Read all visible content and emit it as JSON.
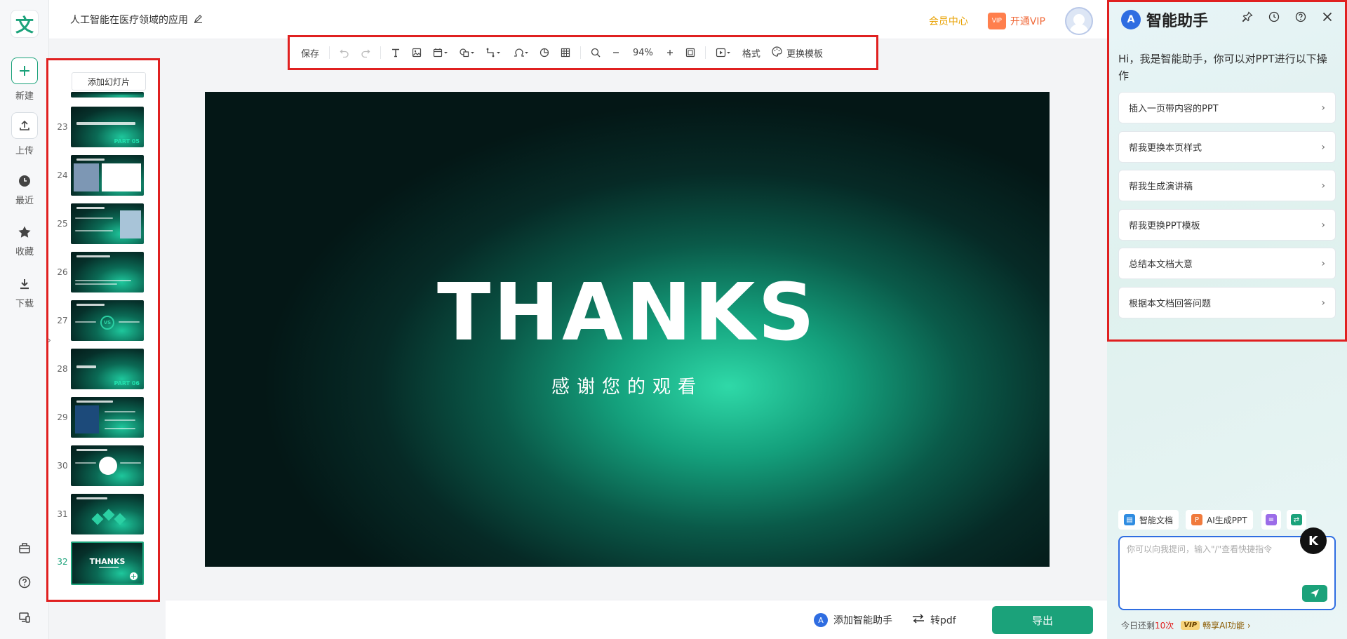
{
  "rail": {
    "logo": "文",
    "items": [
      {
        "label": "新建"
      },
      {
        "label": "上传"
      },
      {
        "label": "最近"
      },
      {
        "label": "收藏"
      },
      {
        "label": "下载"
      }
    ]
  },
  "header": {
    "doc_title": "人工智能在医疗领域的应用",
    "member_center": "会员中心",
    "open_vip": "开通VIP",
    "vip_badge": "VIP"
  },
  "toolbar": {
    "save": "保存",
    "zoom": "94%",
    "format": "格式",
    "change_template": "更换模板"
  },
  "slides": {
    "add_label": "添加幻灯片",
    "items": [
      {
        "num": "23",
        "part": "PART  05"
      },
      {
        "num": "24"
      },
      {
        "num": "25"
      },
      {
        "num": "26"
      },
      {
        "num": "27",
        "vs": "VS"
      },
      {
        "num": "28",
        "part": "PART  06"
      },
      {
        "num": "29"
      },
      {
        "num": "30"
      },
      {
        "num": "31"
      },
      {
        "num": "32",
        "thanks": "THANKS"
      }
    ]
  },
  "canvas": {
    "title": "THANKS",
    "subtitle": "感谢您的观看"
  },
  "bottom": {
    "add_assistant": "添加智能助手",
    "to_pdf": "转pdf",
    "export": "导出"
  },
  "assistant": {
    "title": "智能助手",
    "logo_glyph": "A",
    "greeting": "Hi，我是智能助手，你可以对PPT进行以下操作",
    "options": [
      "插入一页带内容的PPT",
      "帮我更换本页样式",
      "帮我生成演讲稿",
      "帮我更换PPT模板",
      "总结本文档大意",
      "根据本文档回答问题"
    ],
    "quick": {
      "smart_doc": "智能文档",
      "ai_ppt": "AI生成PPT"
    },
    "input_placeholder": "你可以向我提问，输入\"/\"查看快捷指令",
    "remain_prefix": "今日还剩",
    "remain_count": "10次",
    "vip_label": "VIP",
    "vip_feature": "畅享AI功能",
    "float_badge": "K"
  },
  "colors": {
    "accent": "#1ba27a",
    "highlight_border": "#e02020",
    "vip_orange": "#f06a3a",
    "member_gold": "#e8a100",
    "assistant_blue": "#2f6de1"
  }
}
